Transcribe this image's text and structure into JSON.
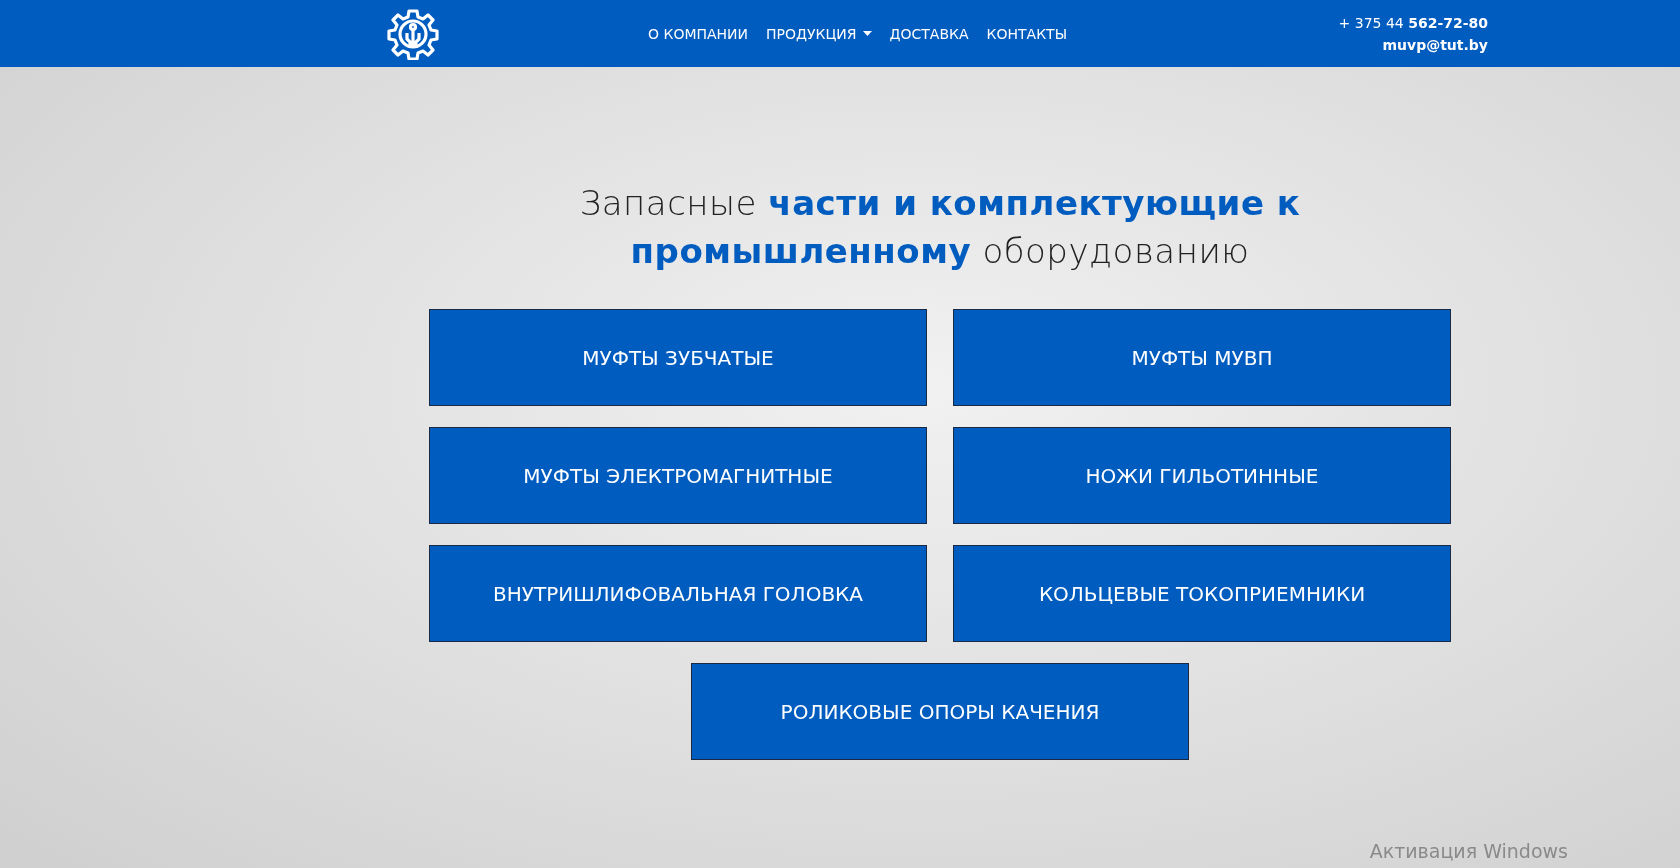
{
  "header": {
    "nav": [
      {
        "label": "О КОМПАНИИ",
        "dropdown": false
      },
      {
        "label": "ПРОДУКЦИЯ",
        "dropdown": true
      },
      {
        "label": "ДОСТАВКА",
        "dropdown": false
      },
      {
        "label": "КОНТАКТЫ",
        "dropdown": false
      }
    ],
    "phone": "+ 375 44 **562-72-80**",
    "email": "muvp@tut.by"
  },
  "hero": {
    "heading": [
      {
        "text": "Запасные ",
        "highlight": false
      },
      {
        "text": "части и комплектующие к промышленному",
        "highlight": true
      },
      {
        "text": " оборудованию",
        "highlight": false
      }
    ],
    "categories": [
      "МУФТЫ ЗУБЧАТЫЕ",
      "МУФТЫ МУВП",
      "МУФТЫ ЭЛЕКТРОМАГНИТНЫЕ",
      "НОЖИ ГИЛЬОТИННЫЕ",
      "ВНУТРИШЛИФОВАЛЬНАЯ ГОЛОВКА",
      "КОЛЬЦЕВЫЕ ТОКОПРИЕМНИКИ",
      "РОЛИКОВЫЕ ОПОРЫ КАЧЕНИЯ"
    ]
  },
  "os_notice": "Активация Windows"
}
